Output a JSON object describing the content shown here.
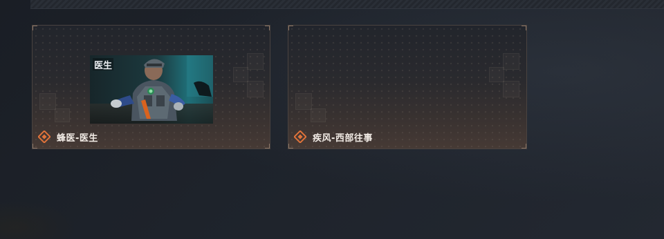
{
  "cards": [
    {
      "title": "蜂医-医生",
      "has_thumbnail": true,
      "thumbnail_logo": "医生",
      "icon": "diamond-icon"
    },
    {
      "title": "疾风-西部往事",
      "has_thumbnail": false,
      "icon": "diamond-icon"
    }
  ],
  "colors": {
    "accent": "#e0733a",
    "card_border": "#4a4340",
    "title_text": "#f2ece6",
    "background": "#1c2027"
  }
}
